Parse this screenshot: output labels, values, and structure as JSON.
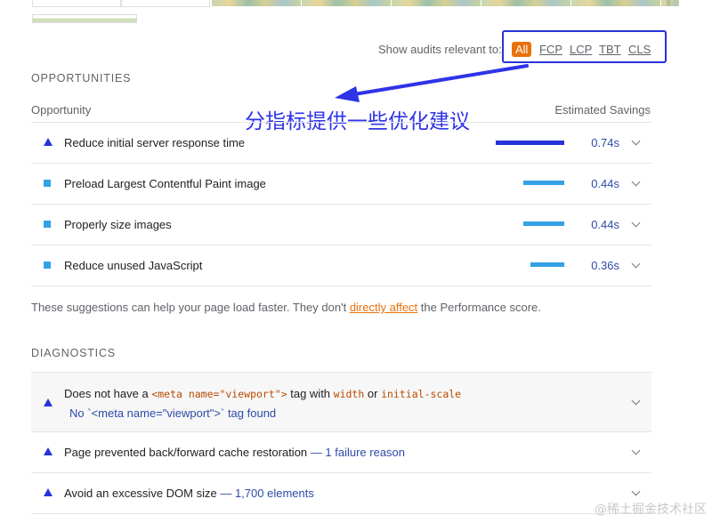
{
  "filter": {
    "label": "Show audits relevant to:",
    "chips": [
      "All",
      "FCP",
      "LCP",
      "TBT",
      "CLS"
    ]
  },
  "annotation": {
    "text": "分指标提供一些优化建议"
  },
  "opportunities": {
    "title": "OPPORTUNITIES",
    "col_left": "Opportunity",
    "col_right": "Estimated Savings",
    "items": [
      {
        "title": "Reduce initial server response time",
        "savings": "0.74s",
        "savings_fraction": 1.0,
        "icon": "warning-triangle-icon"
      },
      {
        "title": "Preload Largest Contentful Paint image",
        "savings": "0.44s",
        "savings_fraction": 0.59,
        "icon": "info-square-icon"
      },
      {
        "title": "Properly size images",
        "savings": "0.44s",
        "savings_fraction": 0.59,
        "icon": "info-square-icon"
      },
      {
        "title": "Reduce unused JavaScript",
        "savings": "0.36s",
        "savings_fraction": 0.49,
        "icon": "info-square-icon"
      }
    ],
    "footnote_before": "These suggestions can help your page load faster. They don't ",
    "footnote_link": "directly affect",
    "footnote_after": " the Performance score."
  },
  "diagnostics": {
    "title": "DIAGNOSTICS",
    "item1": {
      "t1": "Does not have a ",
      "c1": "<meta name=\"viewport\">",
      "t2": " tag with ",
      "c2": "width",
      "t3": " or ",
      "c3": "initial-scale",
      "sub": "No `<meta name=\"viewport\">` tag found"
    },
    "item2": {
      "title": "Page prevented back/forward cache restoration",
      "extra": "— 1 failure reason"
    },
    "item3": {
      "title": "Avoid an excessive DOM size",
      "extra": "— 1,700 elements"
    }
  },
  "colors": {
    "warning": "#2733d8",
    "info": "#33a1e6",
    "accent_orange": "#e8710a",
    "annotation_blue": "#2e33e8"
  },
  "watermark": "@稀土掘金技术社区"
}
